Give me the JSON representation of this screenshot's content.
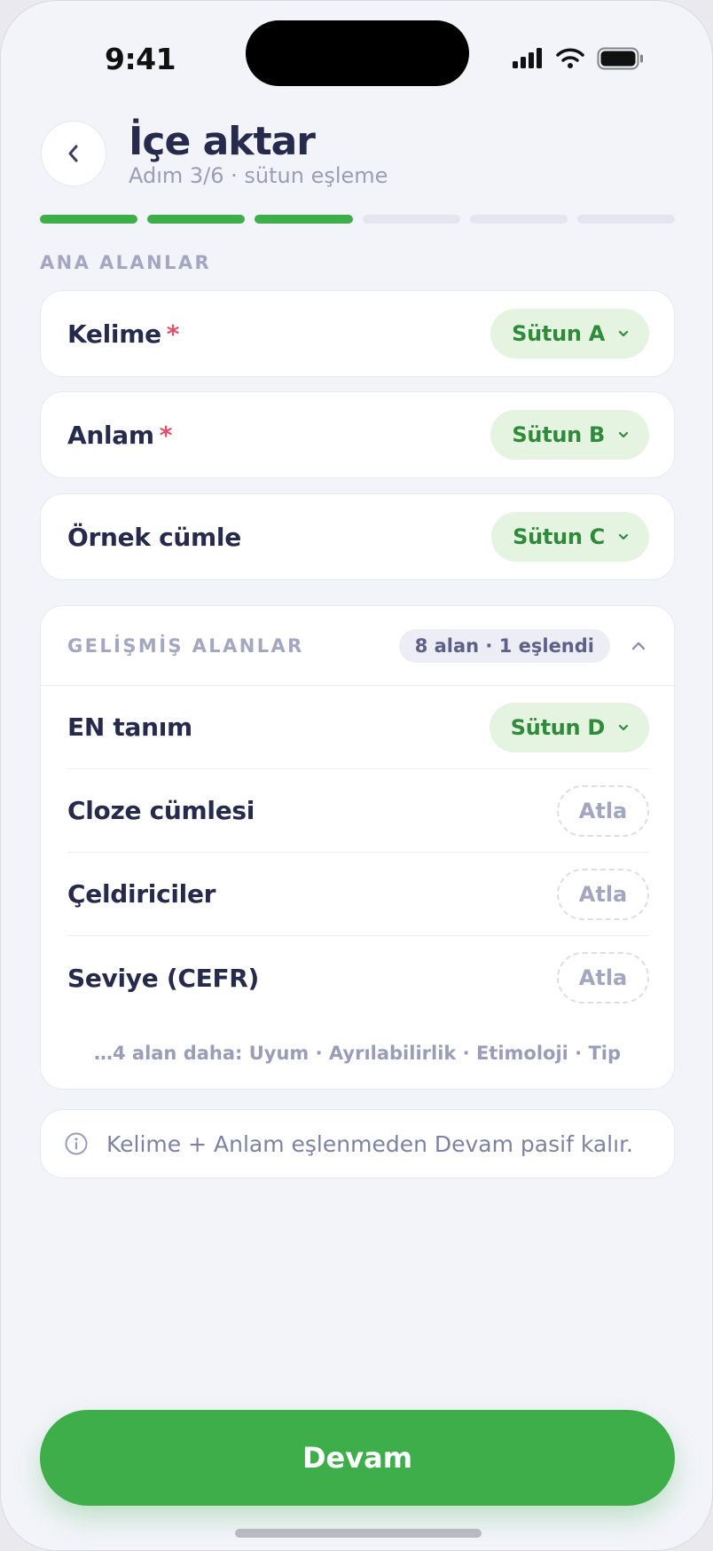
{
  "status": {
    "time": "9:41"
  },
  "header": {
    "title": "İçe aktar",
    "subtitle": "Adım 3/6 · sütun eşleme"
  },
  "progress": {
    "current_step": 3,
    "total_steps": 6
  },
  "main_section": {
    "label": "ANA ALANLAR"
  },
  "fields": [
    {
      "label": "Kelime",
      "required": "*",
      "mapping": "Sütun A"
    },
    {
      "label": "Anlam",
      "required": "*",
      "mapping": "Sütun B"
    },
    {
      "label": "Örnek cümle",
      "required": "",
      "mapping": "Sütun C"
    }
  ],
  "advanced": {
    "title": "GELİŞMİŞ ALANLAR",
    "badge": "8 alan · 1 eşlendi",
    "rows": [
      {
        "label": "EN tanım",
        "mapping": "Sütun D"
      },
      {
        "label": "Cloze cümlesi",
        "skip": "Atla"
      },
      {
        "label": "Çeldiriciler",
        "skip": "Atla"
      },
      {
        "label": "Seviye (CEFR)",
        "skip": "Atla"
      }
    ],
    "more": "…4 alan daha: Uyum · Ayrılabilirlik · Etimoloji · Tip"
  },
  "info": {
    "text": "Kelime + Anlam eşlenmeden Devam pasif kalır."
  },
  "cta": {
    "label": "Devam"
  },
  "colors": {
    "accent": "#3dae4a",
    "pill_bg": "#e4f4e0",
    "pill_text": "#2f8a3a",
    "required": "#e0506a"
  }
}
